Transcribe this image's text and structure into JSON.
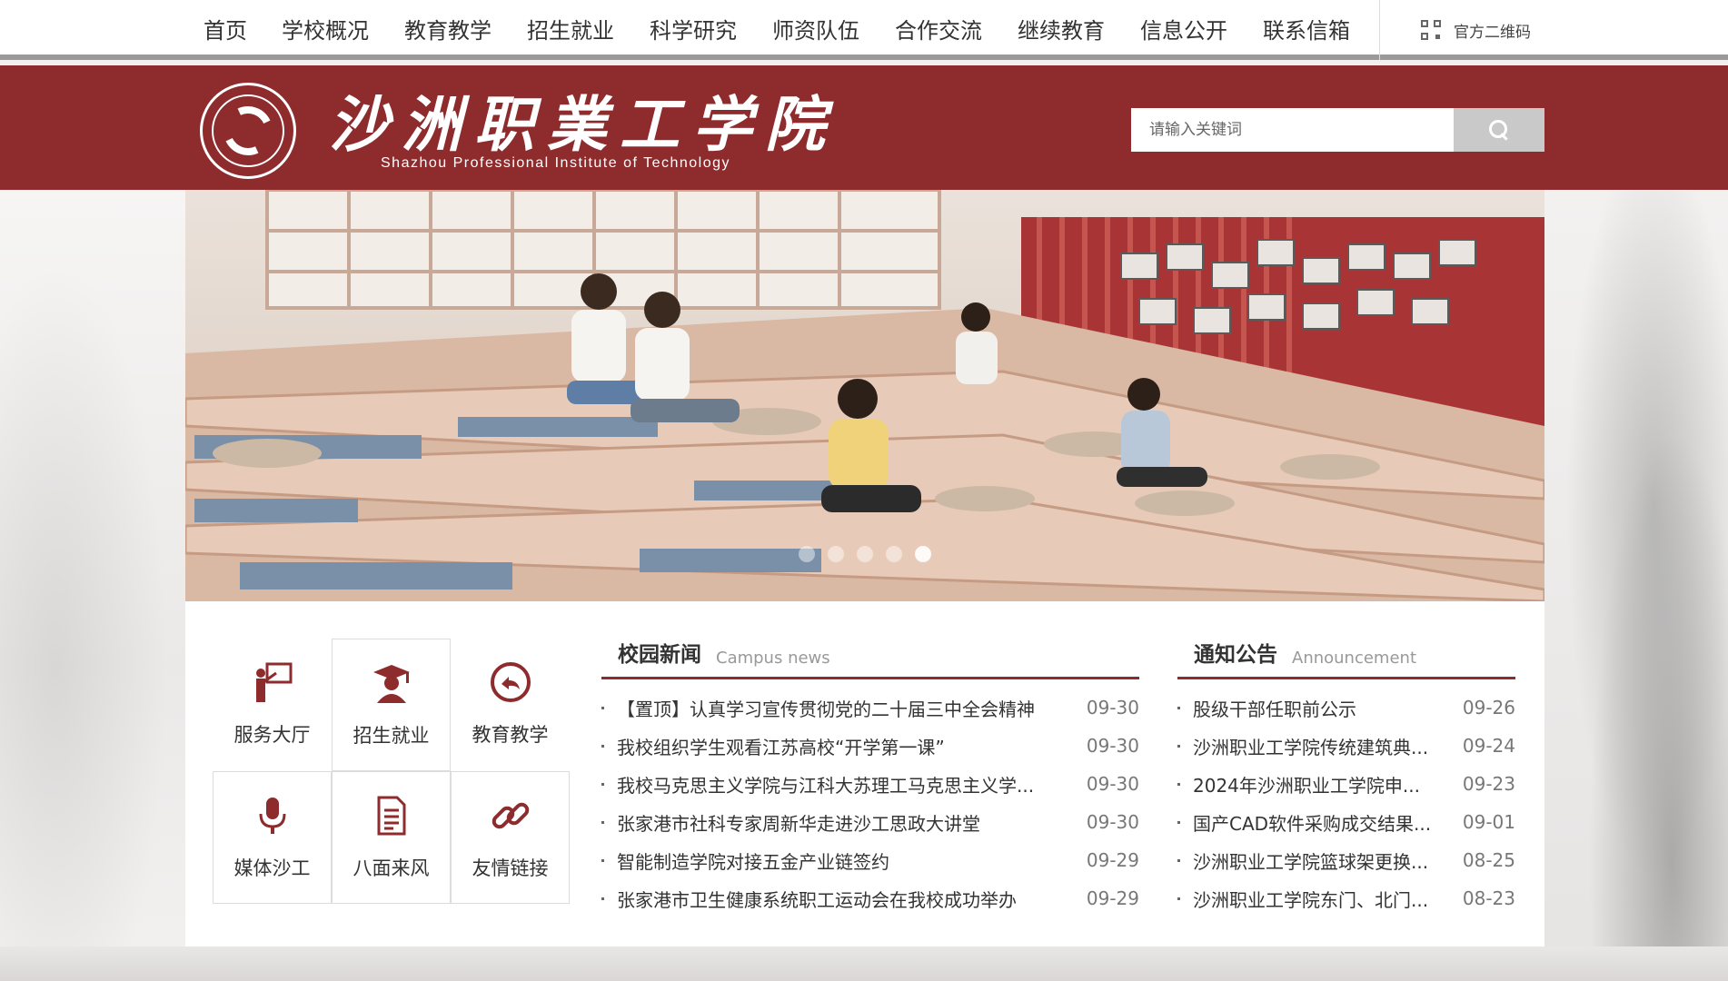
{
  "nav": {
    "items": [
      "首页",
      "学校概况",
      "教育教学",
      "招生就业",
      "科学研究",
      "师资队伍",
      "合作交流",
      "继续教育",
      "信息公开",
      "联系信箱"
    ],
    "qr_label": "官方二维码"
  },
  "header": {
    "logo_cn": "沙洲职業工学院",
    "logo_en": "Shazhou Professional Institute of Technology"
  },
  "search": {
    "placeholder": "请输入关键词"
  },
  "colors": {
    "brand_red": "#8e2b2d",
    "nav_text": "#333333",
    "search_button": "#c9c9c9"
  },
  "banner": {
    "slide_count": 5,
    "active_slide": 5
  },
  "quick_links": [
    {
      "label": "服务大厅",
      "icon": "teacher-board-icon"
    },
    {
      "label": "招生就业",
      "icon": "graduate-cap-icon"
    },
    {
      "label": "教育教学",
      "icon": "circular-arrow-icon"
    },
    {
      "label": "媒体沙工",
      "icon": "microphone-icon"
    },
    {
      "label": "八面来风",
      "icon": "document-icon"
    },
    {
      "label": "友情链接",
      "icon": "chain-link-icon"
    }
  ],
  "campus_news": {
    "title": "校园新闻",
    "subtitle": "Campus news",
    "items": [
      {
        "title": "【置顶】认真学习宣传贯彻党的二十届三中全会精神",
        "date": "09-30"
      },
      {
        "title": "我校组织学生观看江苏高校“开学第一课”",
        "date": "09-30"
      },
      {
        "title": "我校马克思主义学院与江科大苏理工马克思主义学...",
        "date": "09-30"
      },
      {
        "title": "张家港市社科专家周新华走进沙工思政大讲堂",
        "date": "09-30"
      },
      {
        "title": "智能制造学院对接五金产业链签约",
        "date": "09-29"
      },
      {
        "title": "张家港市卫生健康系统职工运动会在我校成功举办",
        "date": "09-29"
      }
    ]
  },
  "announcements": {
    "title": "通知公告",
    "subtitle": "Announcement",
    "items": [
      {
        "title": "股级干部任职前公示",
        "date": "09-26"
      },
      {
        "title": "沙洲职业工学院传统建筑典...",
        "date": "09-24"
      },
      {
        "title": "2024年沙洲职业工学院申...",
        "date": "09-23"
      },
      {
        "title": "国产CAD软件采购成交结果...",
        "date": "09-01"
      },
      {
        "title": "沙洲职业工学院篮球架更换...",
        "date": "08-25"
      },
      {
        "title": "沙洲职业工学院东门、北门...",
        "date": "08-23"
      }
    ]
  }
}
